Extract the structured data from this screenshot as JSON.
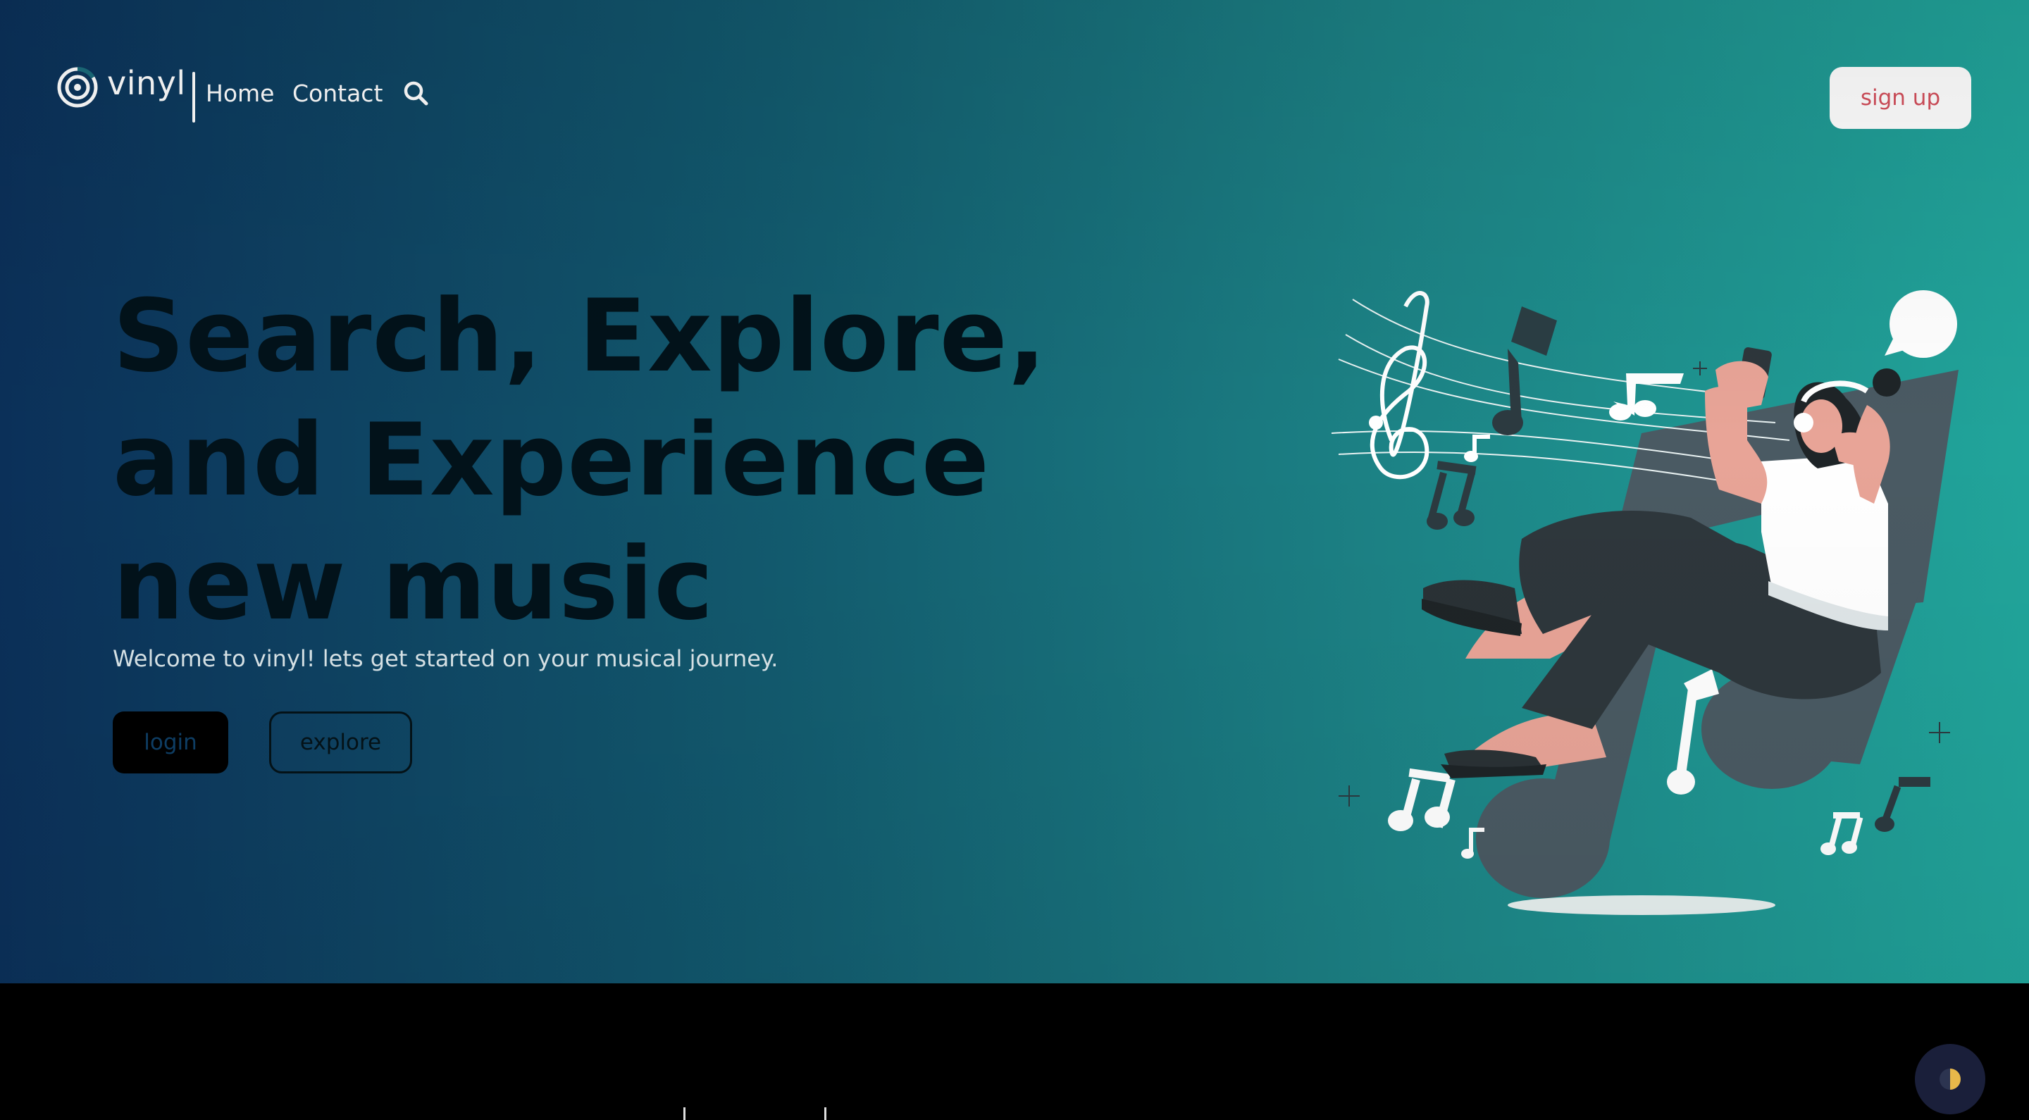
{
  "brand": {
    "name": "vinyl"
  },
  "nav": {
    "links": [
      "Home",
      "Contact"
    ],
    "search_icon": "search-icon",
    "signup_label": "sign up"
  },
  "hero": {
    "headline_lines": [
      "Search, Explore,",
      "and Experience",
      "new music"
    ],
    "subtitle": "Welcome to vinyl! lets get started on your musical journey.",
    "login_label": "login",
    "explore_label": "explore",
    "illustration": "woman-listening-music-illustration"
  },
  "footer": {
    "theme_toggle_icon": "half-moon-icon"
  },
  "colors": {
    "gradient_start": "#0b3059",
    "gradient_end": "#21a59b",
    "signup_text": "#d44f5b",
    "heading": "#02121a",
    "toggle_bg": "#1a1f3a"
  }
}
